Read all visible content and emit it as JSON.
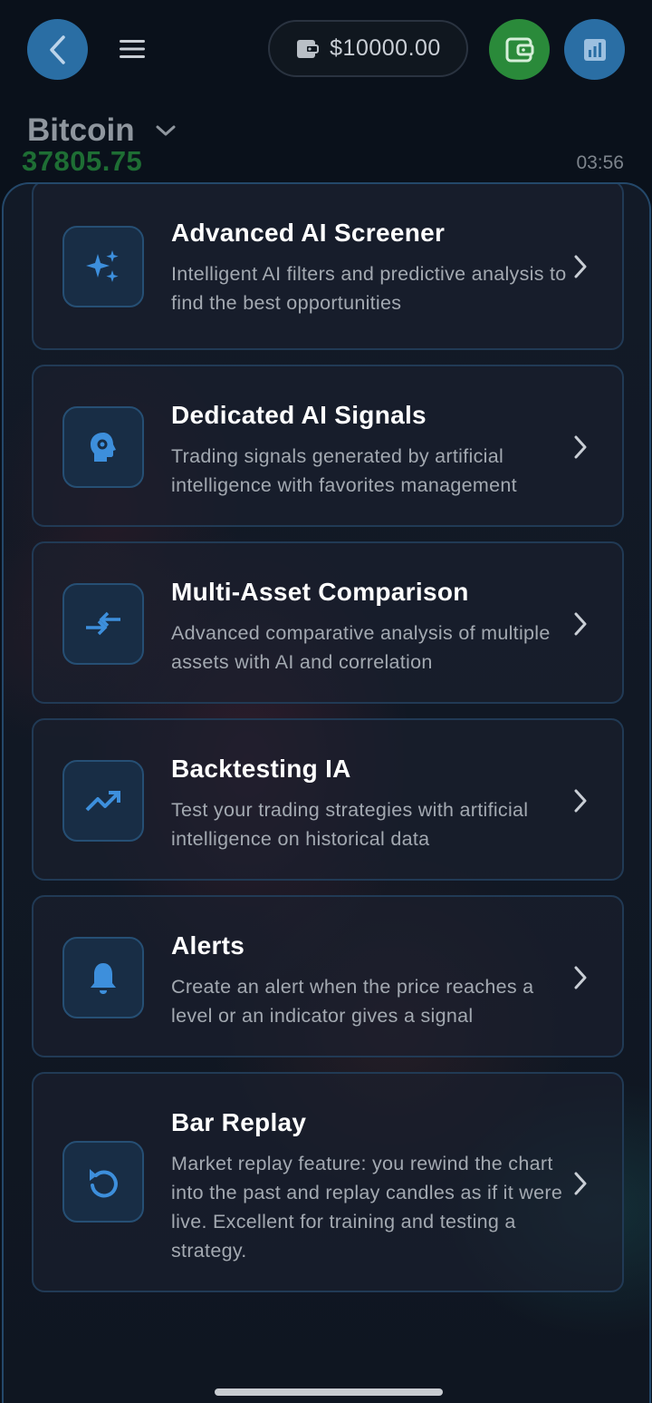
{
  "header": {
    "back_icon": "chevron-left-icon",
    "menu_icon": "hamburger-menu-icon",
    "balance": "$10000.00",
    "wallet_icon": "wallet-icon",
    "stats_icon": "bar-chart-icon"
  },
  "symbol": {
    "name": "Bitcoin",
    "price": "37805.75",
    "time": "03:56"
  },
  "colors": {
    "accent_blue": "#2a6ea4",
    "accent_green": "#2a8a3a",
    "price_green": "#1e6e34",
    "icon_blue": "#3d8fdc"
  },
  "features": [
    {
      "title": "Advanced AI Screener",
      "description": "Intelligent AI filters and predictive analysis to find the best opportunities",
      "icon": "sparkles-icon"
    },
    {
      "title": "Dedicated AI Signals",
      "description": "Trading signals generated by artificial intelligence with favorites management",
      "icon": "ai-head-icon"
    },
    {
      "title": "Multi-Asset Comparison",
      "description": "Advanced comparative analysis of multiple assets with AI and correlation",
      "icon": "compare-arrows-icon"
    },
    {
      "title": "Backtesting IA",
      "description": "Test your trading strategies with artificial intelligence on historical data",
      "icon": "trending-up-icon"
    },
    {
      "title": "Alerts",
      "description": "Create an alert when the price reaches a level or an indicator gives a signal",
      "icon": "bell-icon"
    },
    {
      "title": "Bar Replay",
      "description": "Market replay feature: you rewind the chart into the past and replay candles as if it were live. Excellent for training and testing a strategy.",
      "icon": "replay-icon"
    }
  ]
}
